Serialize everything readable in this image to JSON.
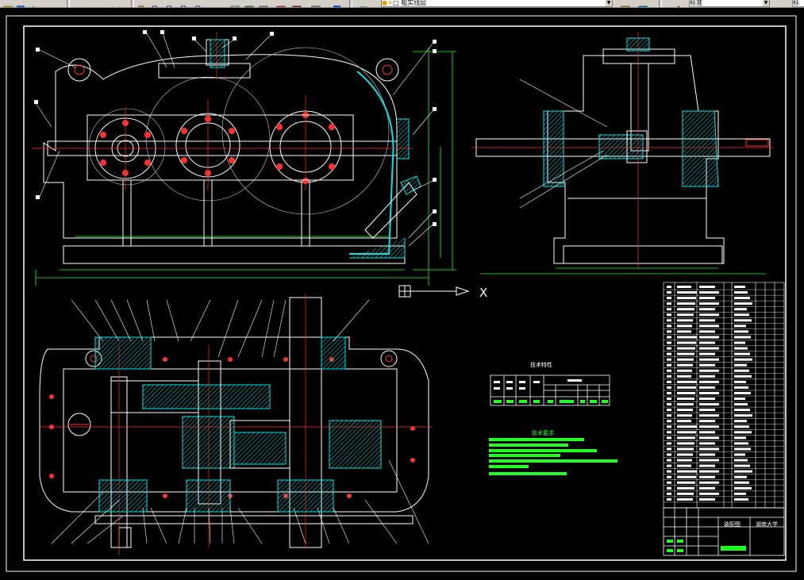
{
  "toolbar": {
    "layer_combo_value": "粗实线层",
    "style_combo_value": "标准",
    "right_combo_value": "标",
    "icons": [
      "open-icon",
      "save-icon",
      "undo-icon",
      "redo-icon",
      "pan-icon",
      "zoom-in-icon",
      "zoom-out-icon",
      "zoom-window-icon",
      "match-properties-icon",
      "properties-icon",
      "layer-icon",
      "design-center-icon",
      "table-icon",
      "help-icon"
    ],
    "colors": {
      "face": "#d4d0c8",
      "shadow": "#808080"
    }
  },
  "drawing": {
    "background": "#000000",
    "line_color": "#ffffff",
    "center_color": "#ff2020",
    "dim_color": "#22ff22",
    "section_color": "#00e5e5",
    "ucs_x_label": "X",
    "tech_table_title": "技术特性",
    "tech_req_title": "技术要求",
    "school_name": "湖南大学",
    "assembly_label": "装配图"
  }
}
